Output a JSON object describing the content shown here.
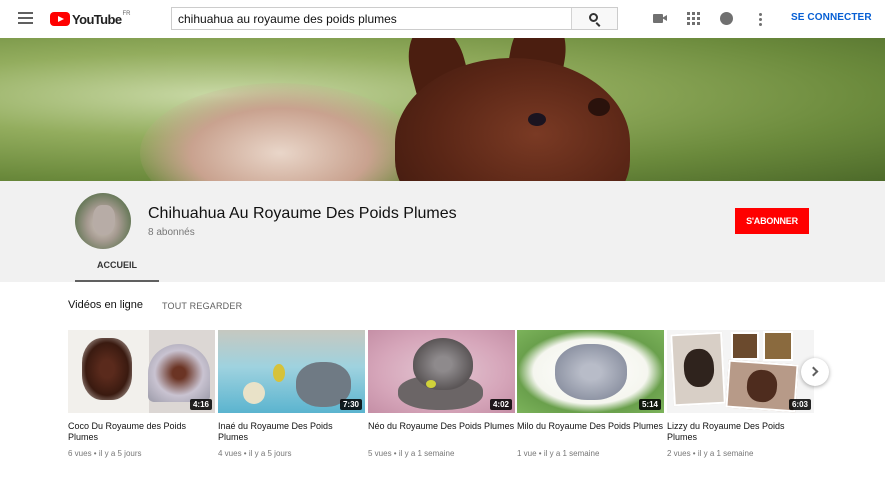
{
  "header": {
    "logo_text": "YouTube",
    "logo_region": "FR",
    "search_value": "chihuahua au royaume des poids plumes",
    "signin_label": "SE CONNECTER"
  },
  "channel": {
    "name": "Chihuahua Au Royaume Des Poids Plumes",
    "subscribers": "8 abonnés",
    "subscribe_label": "S'ABONNER",
    "tab_home": "ACCUEIL"
  },
  "section": {
    "title": "Vidéos en ligne",
    "see_all": "TOUT REGARDER"
  },
  "videos": [
    {
      "title": "Coco Du Royaume des Poids Plumes",
      "duration": "4:16",
      "meta": "6 vues • il y a 5 jours"
    },
    {
      "title": "Inaé du Royaume Des Poids Plumes",
      "duration": "7:30",
      "meta": "4 vues • il y a 5 jours"
    },
    {
      "title": "Néo du Royaume Des Poids Plumes",
      "duration": "4:02",
      "meta": "5 vues • il y a 1 semaine"
    },
    {
      "title": "Milo du Royaume Des Poids Plumes",
      "duration": "5:14",
      "meta": "1 vue • il y a 1 semaine"
    },
    {
      "title": "Lizzy du Royaume Des Poids Plumes",
      "duration": "6:03",
      "meta": "2 vues • il y a 1 semaine"
    }
  ],
  "colors": {
    "brand_red": "#ff0000",
    "link_blue": "#065fd4"
  }
}
